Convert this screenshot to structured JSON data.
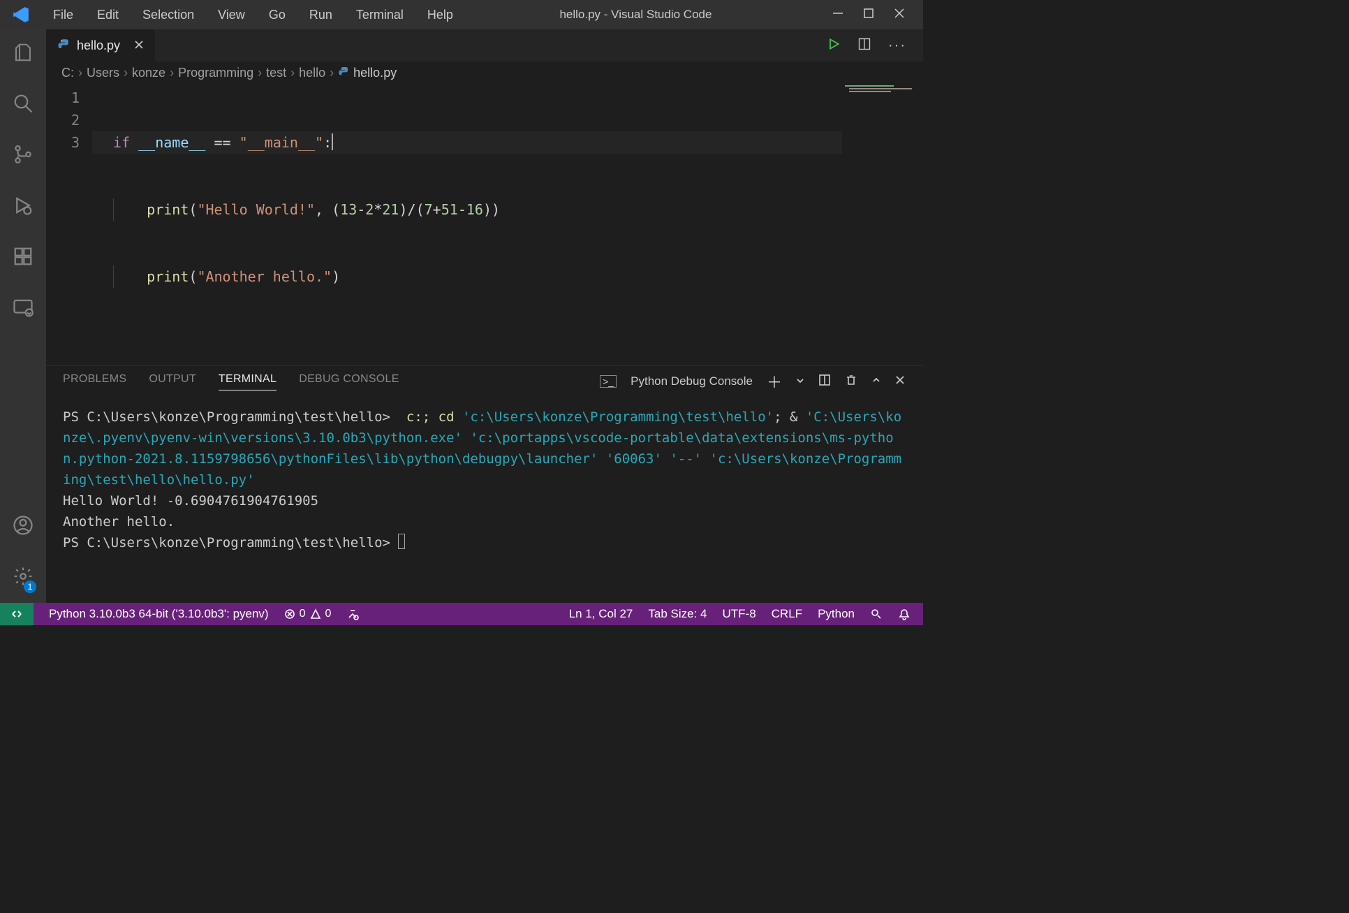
{
  "window_title": "hello.py - Visual Studio Code",
  "menu": [
    "File",
    "Edit",
    "Selection",
    "View",
    "Go",
    "Run",
    "Terminal",
    "Help"
  ],
  "tab": {
    "filename": "hello.py"
  },
  "breadcrumb": [
    "C:",
    "Users",
    "konze",
    "Programming",
    "test",
    "hello",
    "hello.py"
  ],
  "editor": {
    "line_numbers": [
      "1",
      "2",
      "3"
    ],
    "l1": {
      "kw": "if",
      "var": "__name__",
      "eq": "==",
      "str": "\"__main__\"",
      "colon": ":"
    },
    "l2": {
      "fn": "print",
      "open": "(",
      "str": "\"Hello World!\"",
      "comma": ", ",
      "expr_open": "(",
      "n1": "13",
      "minus": "-",
      "n2": "2",
      "star": "*",
      "n3": "21",
      "expr_close": ")",
      "div": "/",
      "den_open": "(",
      "n4": "7",
      "plus": "+",
      "n5": "51",
      "minus2": "-",
      "n6": "16",
      "den_close": ")",
      "close": ")"
    },
    "l3": {
      "fn": "print",
      "open": "(",
      "str": "\"Another hello.\"",
      "close": ")"
    }
  },
  "panel": {
    "tabs": {
      "problems": "PROBLEMS",
      "output": "OUTPUT",
      "terminal": "TERMINAL",
      "debug": "DEBUG CONSOLE"
    },
    "console_name": "Python Debug Console"
  },
  "terminal": {
    "prompt1": "PS C:\\Users\\konze\\Programming\\test\\hello> ",
    "cmd1a": " c:; ",
    "cmd1b": "cd ",
    "path1": "'c:\\Users\\konze\\Programming\\test\\hello'",
    "sep1": "; & ",
    "path2": "'C:\\Users\\konze\\.pyenv\\pyenv-win\\versions\\3.10.0b3\\python.exe' 'c:\\portapps\\vscode-portable\\data\\extensions\\ms-python.python-2021.8.1159798656\\pythonFiles\\lib\\python\\debugpy\\launcher' '60063' '--' 'c:\\Users\\konze\\Programming\\test\\hello\\hello.py'",
    "out1": "Hello World! -0.6904761904761905",
    "out2": "Another hello.",
    "prompt2": "PS C:\\Users\\konze\\Programming\\test\\hello> "
  },
  "status": {
    "interpreter": "Python 3.10.0b3 64-bit ('3.10.0b3': pyenv)",
    "errors": "0",
    "warnings": "0",
    "cursor": "Ln 1, Col 27",
    "tab_size": "Tab Size: 4",
    "encoding": "UTF-8",
    "eol": "CRLF",
    "language": "Python"
  },
  "activity_badge": "1"
}
